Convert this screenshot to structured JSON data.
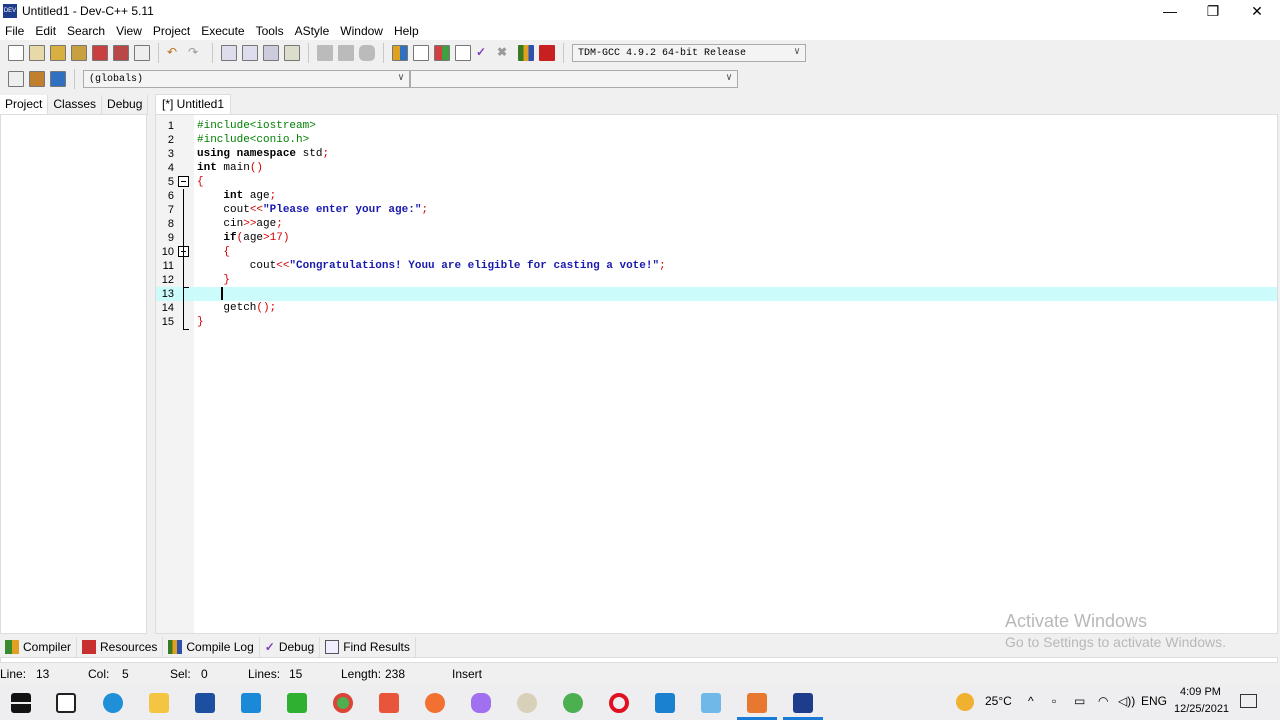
{
  "window": {
    "title": "Untitled1 - Dev-C++ 5.11",
    "minimize": "—",
    "maximize": "❐",
    "close": "✕"
  },
  "menu": [
    "File",
    "Edit",
    "Search",
    "View",
    "Project",
    "Execute",
    "Tools",
    "AStyle",
    "Window",
    "Help"
  ],
  "toolbar": {
    "compiler_select": "TDM-GCC 4.9.2 64-bit Release",
    "globals_select": "(globals)",
    "members_select": ""
  },
  "left_tabs": [
    "Project",
    "Classes",
    "Debug"
  ],
  "editor_tab": "[*] Untitled1",
  "code": [
    [
      [
        "#include<iostream>",
        "pp"
      ]
    ],
    [
      [
        "#include<conio.h>",
        "pp"
      ]
    ],
    [
      [
        "using namespace ",
        "kw"
      ],
      [
        "std",
        "id"
      ],
      [
        ";",
        "op"
      ]
    ],
    [
      [
        "int ",
        "kw"
      ],
      [
        "main",
        "id"
      ],
      [
        "()",
        "op"
      ]
    ],
    [
      [
        "{",
        "op"
      ]
    ],
    [
      [
        "    int ",
        "kw"
      ],
      [
        "age",
        "id"
      ],
      [
        ";",
        "op"
      ]
    ],
    [
      [
        "    cout",
        "id"
      ],
      [
        "<<",
        "op"
      ],
      [
        "\"Please enter your age:\"",
        "str"
      ],
      [
        ";",
        "op"
      ]
    ],
    [
      [
        "    cin",
        "id"
      ],
      [
        ">>",
        "op"
      ],
      [
        "age",
        "id"
      ],
      [
        ";",
        "op"
      ]
    ],
    [
      [
        "    if",
        "kw"
      ],
      [
        "(",
        "op"
      ],
      [
        "age",
        "id"
      ],
      [
        ">",
        "op"
      ],
      [
        "17",
        "num"
      ],
      [
        ")",
        "op"
      ]
    ],
    [
      [
        "    {",
        "op"
      ]
    ],
    [
      [
        "        cout",
        "id"
      ],
      [
        "<<",
        "op"
      ],
      [
        "\"Congratulations! Youu are eligible for casting a vote!\"",
        "str"
      ],
      [
        ";",
        "op"
      ]
    ],
    [
      [
        "    }",
        "op"
      ]
    ],
    [
      [
        "",
        ""
      ]
    ],
    [
      [
        "    getch",
        "id"
      ],
      [
        "();",
        "op"
      ]
    ],
    [
      [
        "}",
        "op"
      ]
    ]
  ],
  "current_line": 13,
  "bottom_tabs": [
    "Compiler",
    "Resources",
    "Compile Log",
    "Debug",
    "Find Results"
  ],
  "status": {
    "line_label": "Line:",
    "line": "13",
    "col_label": "Col:",
    "col": "5",
    "sel_label": "Sel:",
    "sel": "0",
    "lines_label": "Lines:",
    "lines": "15",
    "length_label": "Length:",
    "length": "238",
    "mode": "Insert"
  },
  "watermark": {
    "title": "Activate Windows",
    "subtitle": "Go to Settings to activate Windows."
  },
  "taskbar": {
    "weather": "25°C",
    "lang": "ENG",
    "time": "4:09 PM",
    "date": "12/25/2021"
  }
}
